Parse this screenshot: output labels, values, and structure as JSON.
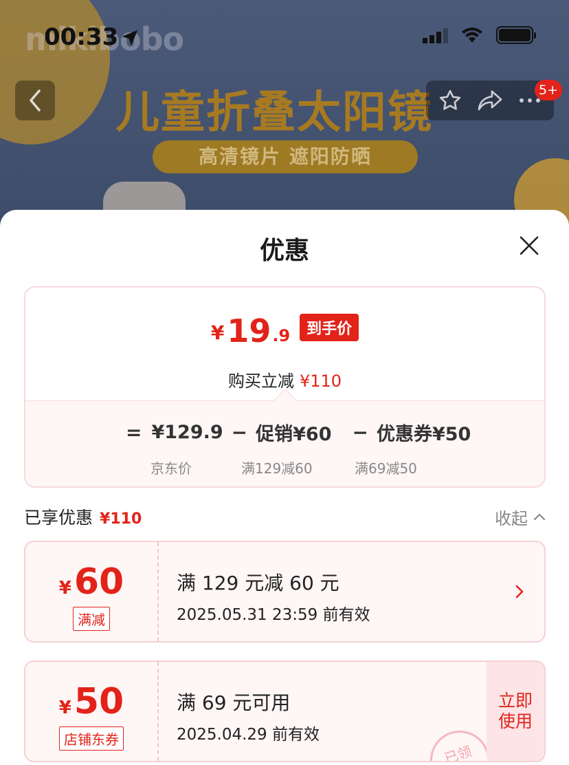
{
  "status_bar": {
    "time": "00:33"
  },
  "banner": {
    "brand": "mikibobo",
    "title": "儿童折叠太阳镜",
    "tagline": "高清镜片 遮阳防晒"
  },
  "nav": {
    "more_badge": "5+"
  },
  "sheet": {
    "title": "优惠",
    "summary": {
      "price_symbol": "¥",
      "price_int": "19",
      "price_dec": ".9",
      "price_tag": "到手价",
      "saving_label": "购买立减",
      "saving_amount": "¥110",
      "formula": {
        "eq": "=",
        "base": "¥129.9",
        "base_label": "京东价",
        "minus1": "−",
        "promo": "促销¥60",
        "promo_label": "满129减60",
        "minus2": "−",
        "coupon": "优惠券¥50",
        "coupon_label": "满69减50"
      }
    },
    "enjoyed": {
      "label": "已享优惠",
      "amount": "¥110",
      "collapse": "收起"
    },
    "coupons": [
      {
        "symbol": "¥",
        "amount": "60",
        "type": "满减",
        "rule": "满 129 元减 60 元",
        "valid": "2025.05.31 23:59 前有效"
      },
      {
        "symbol": "¥",
        "amount": "50",
        "type": "店铺东券",
        "rule": "满 69 元可用",
        "valid": "2025.04.29 前有效",
        "action": "立即使用",
        "stamp": "已领"
      }
    ]
  },
  "colors": {
    "accent": "#e2231a",
    "card_bg": "#fff6f6",
    "border": "#f7d9dd"
  }
}
